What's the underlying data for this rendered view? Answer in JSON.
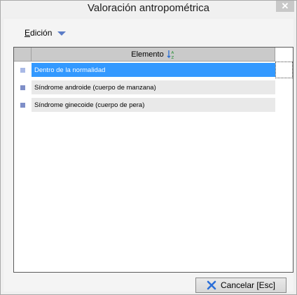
{
  "window": {
    "title": "Valoración antropométrica",
    "close_glyph": "✕"
  },
  "toolbar": {
    "menu_label_first": "E",
    "menu_label_rest": "dición"
  },
  "grid": {
    "column_header": "Elemento",
    "rows": [
      {
        "label": "Dentro de la normalidad",
        "selected": true
      },
      {
        "label": "Síndrome androide (cuerpo de manzana)",
        "selected": false
      },
      {
        "label": "Síndrome ginecoide (cuerpo de pera)",
        "selected": false
      }
    ]
  },
  "footer": {
    "cancel_label": "Cancelar [Esc]"
  },
  "colors": {
    "selection": "#3399ff",
    "accent": "#5b7cc6"
  }
}
